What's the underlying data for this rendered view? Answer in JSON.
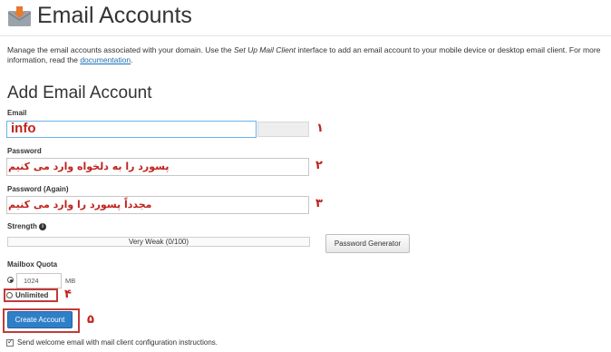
{
  "header": {
    "title": "Email Accounts",
    "icon": "email-accounts-icon",
    "description_part1": "Manage the email accounts associated with your domain. Use the ",
    "description_em": "Set Up Mail Client",
    "description_part2": " interface to add an email account to your mobile device or desktop email client. For more information, read the ",
    "description_link": "documentation",
    "description_end": "."
  },
  "form": {
    "section_title": "Add Email Account",
    "email_label": "Email",
    "email_value": "info",
    "password_label": "Password",
    "password_annotation": "پسورد را به دلخواه وارد می کنیم",
    "password_again_label": "Password (Again)",
    "password_again_annotation": "مجدداً پسورد را وارد می کنیم",
    "strength_label": "Strength",
    "strength_value": "Very Weak (0/100)",
    "password_generator_label": "Password Generator",
    "quota_label": "Mailbox Quota",
    "quota_value": "1024",
    "quota_unit": "MB",
    "unlimited_label": "Unlimited",
    "create_button_label": "Create Account",
    "welcome_checkbox_label": "Send welcome email with mail client configuration instructions.",
    "welcome_checkbox_checked": true
  },
  "annotations": {
    "step1": "۱",
    "step2": "۲",
    "step3": "۳",
    "step4": "۴",
    "step5": "۵",
    "color": "#c0221d"
  },
  "colors": {
    "primary_button": "#2f7fc8",
    "annotation_red": "#c0221d",
    "focus_border": "#6fb1e6"
  }
}
